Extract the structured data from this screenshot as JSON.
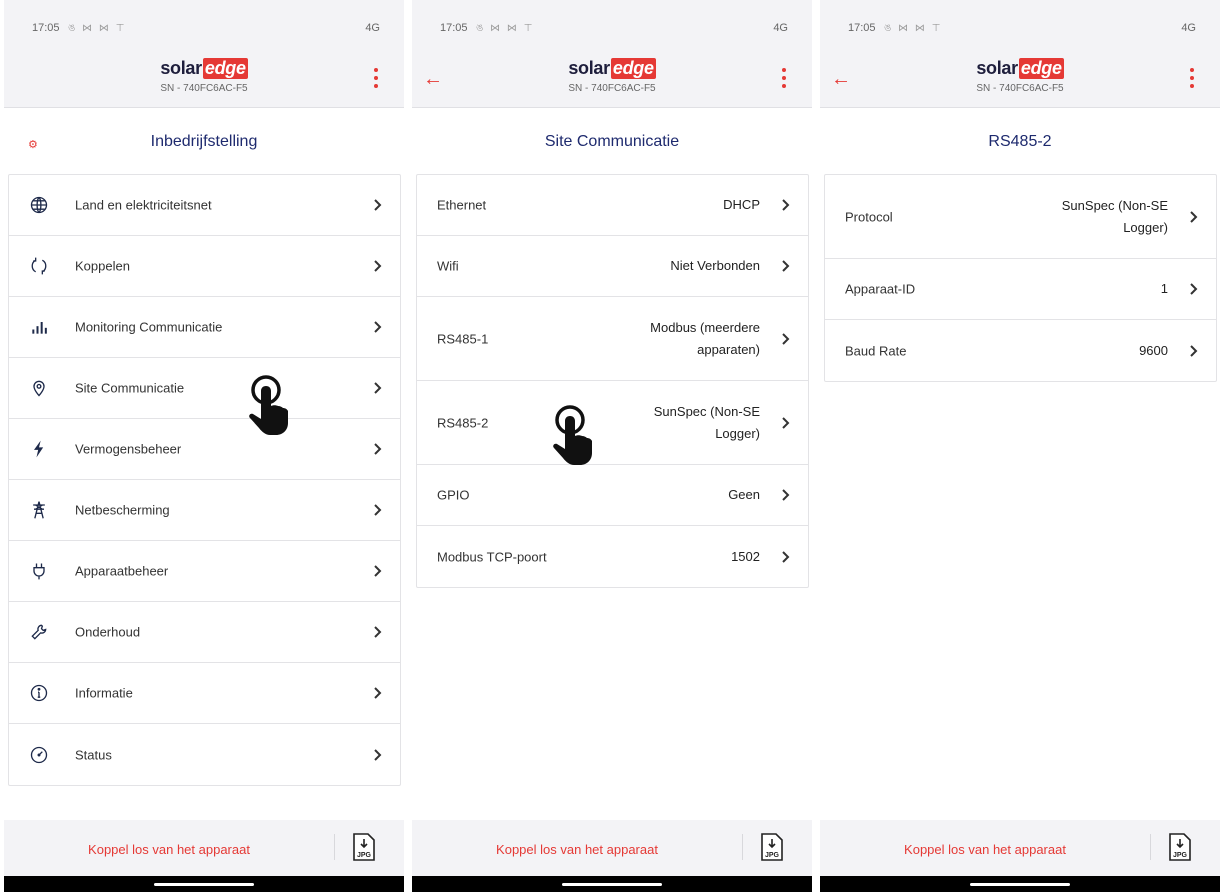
{
  "status_bar": {
    "time": "17:05",
    "icons": "ঙ ⋈ ⋈ ⊤",
    "network": "4G"
  },
  "app": {
    "logo_solar": "solar",
    "logo_edge": "edge",
    "serial": "SN - 740FC6AC-F5"
  },
  "screens": [
    {
      "title": "Inbedrijfstelling",
      "items": [
        {
          "label": "Land en elektriciteitsnet",
          "icon": "globe-icon"
        },
        {
          "label": "Koppelen",
          "icon": "sync-icon"
        },
        {
          "label": "Monitoring Communicatie",
          "icon": "bar-chart-icon"
        },
        {
          "label": "Site Communicatie",
          "icon": "location-pin-icon"
        },
        {
          "label": "Vermogensbeheer",
          "icon": "lightning-icon"
        },
        {
          "label": "Netbescherming",
          "icon": "power-tower-icon"
        },
        {
          "label": "Apparaatbeheer",
          "icon": "plug-icon"
        },
        {
          "label": "Onderhoud",
          "icon": "wrench-icon"
        },
        {
          "label": "Informatie",
          "icon": "info-icon"
        },
        {
          "label": "Status",
          "icon": "gauge-icon"
        }
      ]
    },
    {
      "title": "Site Communicatie",
      "items": [
        {
          "label": "Ethernet",
          "value_line1": "DHCP"
        },
        {
          "label": "Wifi",
          "value_line1": "Niet Verbonden"
        },
        {
          "label": "RS485-1",
          "value_line1": "Modbus (meerdere",
          "value_line2": "apparaten)"
        },
        {
          "label": "RS485-2",
          "value_line1": "SunSpec (Non-SE",
          "value_line2": "Logger)"
        },
        {
          "label": "GPIO",
          "value_line1": "Geen"
        },
        {
          "label": "Modbus TCP-poort",
          "value_line1": "1502"
        }
      ]
    },
    {
      "title": "RS485-2",
      "items": [
        {
          "label": "Protocol",
          "value_line1": "SunSpec (Non-SE",
          "value_line2": "Logger)"
        },
        {
          "label": "Apparaat-ID",
          "value_line1": "1"
        },
        {
          "label": "Baud Rate",
          "value_line1": "9600"
        }
      ]
    }
  ],
  "footer": {
    "disconnect_label": "Koppel los van het apparaat",
    "export_label": "JPG"
  },
  "colors": {
    "accent": "#e53935",
    "title": "#1e2a6e",
    "bar_bg": "#f3f3f6"
  }
}
